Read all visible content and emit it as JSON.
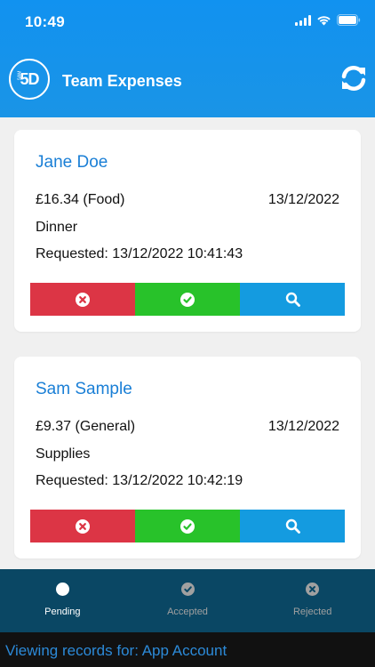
{
  "status_bar": {
    "time": "10:49"
  },
  "header": {
    "logo_text": "5D",
    "logo_small": "SAM",
    "title": "Team Expenses"
  },
  "colors": {
    "header": "#1a94e6",
    "reject": "#dc3545",
    "accept": "#28c22a",
    "view": "#149be0",
    "name": "#1a7fd6",
    "tabbar": "#0a4764"
  },
  "expenses": [
    {
      "name": "Jane Doe",
      "amount": "£16.34 (Food)",
      "date": "13/12/2022",
      "description": "Dinner",
      "requested": "Requested: 13/12/2022 10:41:43"
    },
    {
      "name": "Sam Sample",
      "amount": "£9.37 (General)",
      "date": "13/12/2022",
      "description": "Supplies",
      "requested": "Requested: 13/12/2022 10:42:19"
    }
  ],
  "tabs": [
    {
      "label": "Pending",
      "icon": "circle-icon",
      "active": true
    },
    {
      "label": "Accepted",
      "icon": "check-circle-icon",
      "active": false
    },
    {
      "label": "Rejected",
      "icon": "x-circle-icon",
      "active": false
    }
  ],
  "footer": {
    "text": "Viewing records for: App Account"
  }
}
